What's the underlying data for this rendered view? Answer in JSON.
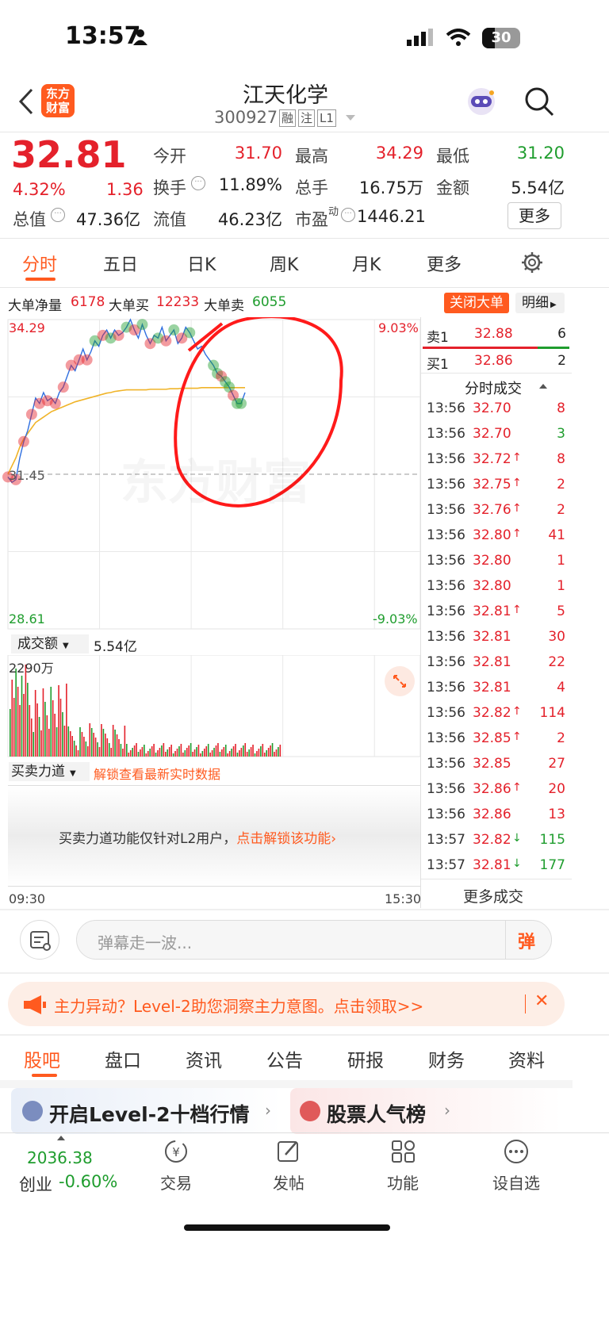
{
  "status_bar": {
    "time": "13:57",
    "battery": "30"
  },
  "header": {
    "logo_text": "东方财富",
    "title": "江天化学",
    "code": "300927",
    "tags": [
      "融",
      "注",
      "L1"
    ]
  },
  "quote": {
    "price": "32.81",
    "pct": "4.32%",
    "chg": "1.36",
    "fields": [
      {
        "label": "今开",
        "value": "31.70"
      },
      {
        "label": "最高",
        "value": "34.29"
      },
      {
        "label": "最低",
        "value": "31.20"
      },
      {
        "label": "换手",
        "value": "11.89%"
      },
      {
        "label": "总手",
        "value": "16.75万"
      },
      {
        "label": "金额",
        "value": "5.54亿"
      },
      {
        "label": "总值",
        "value": "47.36亿"
      },
      {
        "label": "流值",
        "value": "46.23亿"
      },
      {
        "label": "市盈",
        "sup": "动",
        "value": "1446.21"
      }
    ],
    "more_button": "更多"
  },
  "chart_tabs": {
    "items": [
      "分时",
      "五日",
      "日K",
      "周K",
      "月K",
      "更多"
    ],
    "active": 0
  },
  "big_order": {
    "net_label": "大单净量",
    "net": "6178",
    "buy_label": "大单买",
    "buy": "12233",
    "sell_label": "大单卖",
    "sell": "6055",
    "close_button": "关闭大单",
    "detail_button": "明细"
  },
  "chart": {
    "y_high": "34.29",
    "y_low": "28.61",
    "pct_high": "9.03%",
    "pct_low": "-9.03%",
    "prev_close": "31.45",
    "watermark": "东方财富",
    "time_start": "09:30",
    "time_end": "15:30"
  },
  "chart_data": {
    "type": "line",
    "prev_close": 31.45,
    "ylim": [
      28.61,
      34.29
    ],
    "price": [
      31.4,
      31.3,
      31.35,
      31.75,
      32.05,
      32.25,
      32.55,
      32.85,
      32.75,
      32.95,
      32.8,
      32.85,
      32.75,
      32.95,
      33.05,
      33.25,
      33.45,
      33.35,
      33.55,
      33.75,
      33.55,
      33.7,
      33.9,
      33.8,
      34.0,
      34.1,
      33.95,
      34.1,
      34.0,
      34.05,
      34.15,
      34.29,
      34.1,
      33.95,
      34.2,
      34.0,
      33.85,
      34.0,
      33.95,
      34.15,
      33.9,
      34.0,
      34.1,
      33.85,
      33.95,
      34.15,
      34.05,
      33.9,
      33.75,
      33.8,
      33.65,
      33.55,
      33.45,
      33.3,
      33.25,
      33.15,
      33.05,
      32.9,
      32.75,
      32.75,
      32.95
    ],
    "avg": [
      31.45,
      31.6,
      31.75,
      31.95,
      32.1,
      32.2,
      32.3,
      32.4,
      32.45,
      32.5,
      32.55,
      32.6,
      32.63,
      32.66,
      32.69,
      32.72,
      32.75,
      32.78,
      32.8,
      32.82,
      32.84,
      32.86,
      32.88,
      32.9,
      32.92,
      32.94,
      32.95,
      32.97,
      32.98,
      32.99,
      33.0,
      33.0,
      33.0,
      33.0,
      33.0,
      33.0,
      33.01,
      33.01,
      33.01,
      33.01,
      33.01,
      33.02,
      33.02,
      33.02,
      33.03,
      33.03,
      33.03,
      33.03,
      33.03,
      33.04,
      33.04,
      33.04,
      33.04,
      33.04,
      33.04,
      33.04,
      33.04,
      33.04,
      33.04,
      33.04,
      33.04
    ]
  },
  "volume": {
    "label": "成交额",
    "value": "5.54亿",
    "max": "2290万"
  },
  "force": {
    "label": "买卖力道",
    "unlock": "解锁查看最新实时数据",
    "notice": "买卖力道功能仅针对L2用户，",
    "notice_link": "点击解锁该功能"
  },
  "order_book": {
    "sell": {
      "label": "卖1",
      "price": "32.88",
      "qty": "6"
    },
    "buy": {
      "label": "买1",
      "price": "32.86",
      "qty": "2"
    },
    "ticks_title": "分时成交"
  },
  "ticks": [
    {
      "t": "13:56",
      "p": "32.70",
      "a": "",
      "q": "8",
      "pc": "red",
      "qc": "red"
    },
    {
      "t": "13:56",
      "p": "32.70",
      "a": "",
      "q": "3",
      "pc": "red",
      "qc": "green"
    },
    {
      "t": "13:56",
      "p": "32.72",
      "a": "↑",
      "q": "8",
      "pc": "red",
      "qc": "red"
    },
    {
      "t": "13:56",
      "p": "32.75",
      "a": "↑",
      "q": "2",
      "pc": "red",
      "qc": "red"
    },
    {
      "t": "13:56",
      "p": "32.76",
      "a": "↑",
      "q": "2",
      "pc": "red",
      "qc": "red"
    },
    {
      "t": "13:56",
      "p": "32.80",
      "a": "↑",
      "q": "41",
      "pc": "red",
      "qc": "red"
    },
    {
      "t": "13:56",
      "p": "32.80",
      "a": "",
      "q": "1",
      "pc": "red",
      "qc": "red"
    },
    {
      "t": "13:56",
      "p": "32.80",
      "a": "",
      "q": "1",
      "pc": "red",
      "qc": "red"
    },
    {
      "t": "13:56",
      "p": "32.81",
      "a": "↑",
      "q": "5",
      "pc": "red",
      "qc": "red"
    },
    {
      "t": "13:56",
      "p": "32.81",
      "a": "",
      "q": "30",
      "pc": "red",
      "qc": "red"
    },
    {
      "t": "13:56",
      "p": "32.81",
      "a": "",
      "q": "22",
      "pc": "red",
      "qc": "red"
    },
    {
      "t": "13:56",
      "p": "32.81",
      "a": "",
      "q": "4",
      "pc": "red",
      "qc": "red"
    },
    {
      "t": "13:56",
      "p": "32.82",
      "a": "↑",
      "q": "114",
      "pc": "red",
      "qc": "red"
    },
    {
      "t": "13:56",
      "p": "32.85",
      "a": "↑",
      "q": "2",
      "pc": "red",
      "qc": "red"
    },
    {
      "t": "13:56",
      "p": "32.85",
      "a": "",
      "q": "27",
      "pc": "red",
      "qc": "red"
    },
    {
      "t": "13:56",
      "p": "32.86",
      "a": "↑",
      "q": "20",
      "pc": "red",
      "qc": "red"
    },
    {
      "t": "13:56",
      "p": "32.86",
      "a": "",
      "q": "13",
      "pc": "red",
      "qc": "red"
    },
    {
      "t": "13:57",
      "p": "32.82",
      "a": "↓",
      "q": "115",
      "pc": "red",
      "qc": "green"
    },
    {
      "t": "13:57",
      "p": "32.81",
      "a": "↓",
      "q": "177",
      "pc": "red",
      "qc": "green"
    }
  ],
  "more_trades": "更多成交",
  "comment": {
    "placeholder": "弹幕走一波...",
    "danmu": "弹"
  },
  "promo": {
    "text": "主力异动？Level-2助您洞察主力意图。点击领取>>"
  },
  "section_tabs": {
    "items": [
      "股吧",
      "盘口",
      "资讯",
      "公告",
      "研报",
      "财务",
      "资料"
    ],
    "active": 0
  },
  "cards": [
    {
      "label": "开启Level-2十档行情"
    },
    {
      "label": "股票人气榜"
    }
  ],
  "bottom_nav": {
    "index_value": "2036.38",
    "index_name": "创业",
    "index_pct": "-0.60%",
    "items": [
      "交易",
      "发帖",
      "功能",
      "设自选"
    ]
  },
  "colors": {
    "up": "#e4212b",
    "down": "#1f9d2e",
    "accent": "#ff5a1f",
    "avg_line": "#f0b429",
    "price_line": "#2f6fe0"
  }
}
